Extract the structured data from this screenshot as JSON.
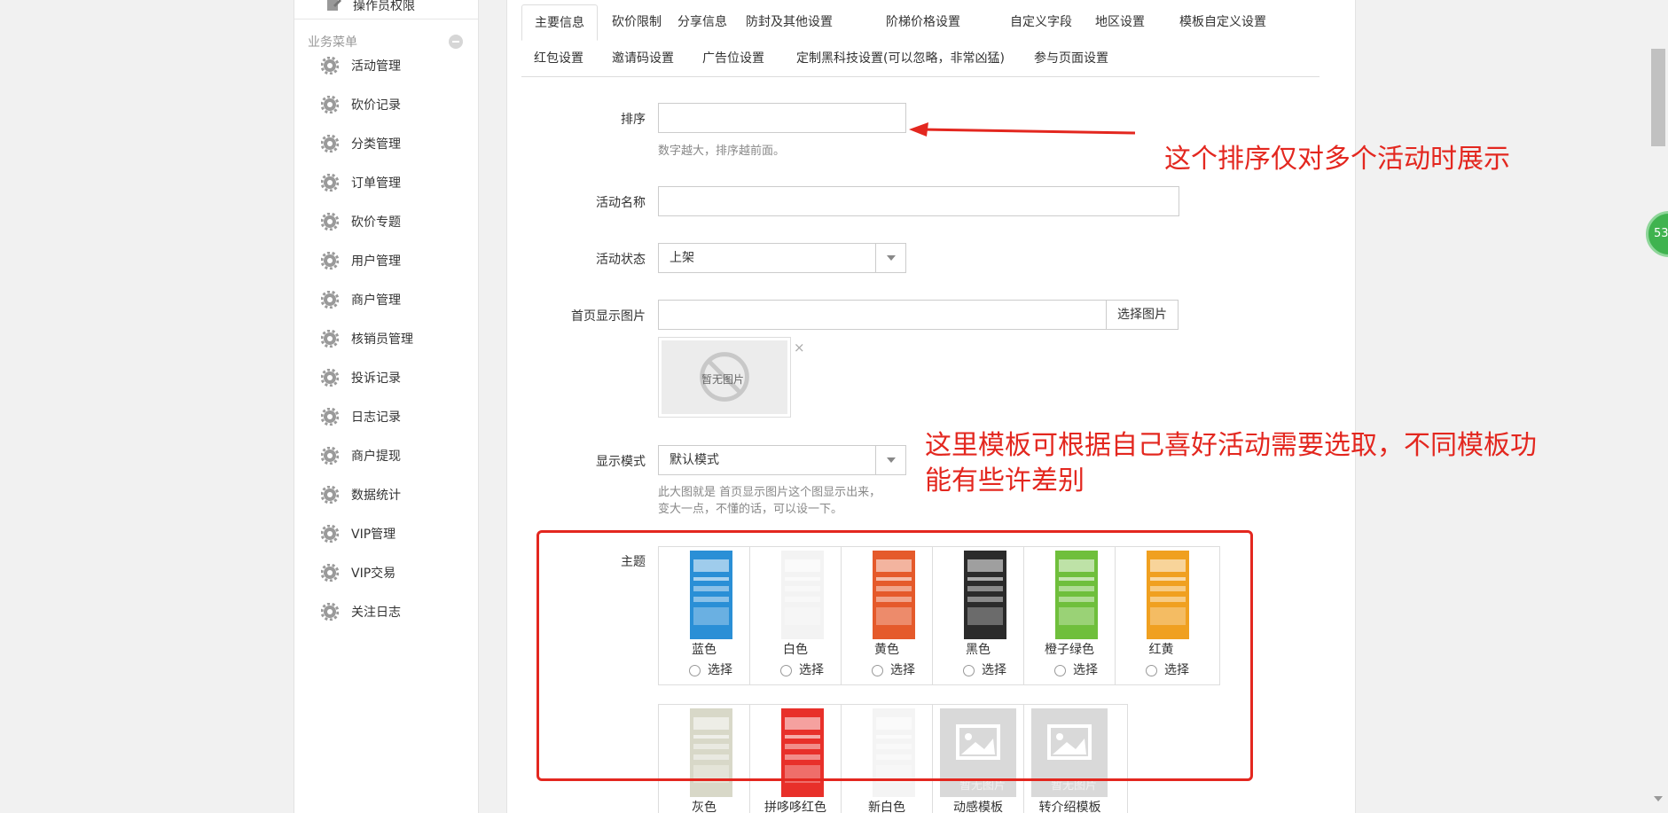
{
  "sidebar": {
    "top_item": "操作员权限",
    "group_title": "业务菜单",
    "items": [
      {
        "label": "活动管理"
      },
      {
        "label": "砍价记录"
      },
      {
        "label": "分类管理"
      },
      {
        "label": "订单管理"
      },
      {
        "label": "砍价专题"
      },
      {
        "label": "用户管理"
      },
      {
        "label": "商户管理"
      },
      {
        "label": "核销员管理"
      },
      {
        "label": "投诉记录"
      },
      {
        "label": "日志记录"
      },
      {
        "label": "商户提现"
      },
      {
        "label": "数据统计"
      },
      {
        "label": "VIP管理"
      },
      {
        "label": "VIP交易"
      },
      {
        "label": "关注日志"
      }
    ]
  },
  "tabs": {
    "row1": [
      "主要信息",
      "砍价限制",
      "分享信息",
      "防封及其他设置",
      "阶梯价格设置",
      "自定义字段",
      "地区设置",
      "模板自定义设置"
    ],
    "row2": [
      "红包设置",
      "邀请码设置",
      "广告位设置",
      "定制黑科技设置(可以忽略，非常凶猛)",
      "参与页面设置"
    ],
    "active": "主要信息"
  },
  "form": {
    "sort": {
      "label": "排序",
      "value": "",
      "help": "数字越大，排序越前面。"
    },
    "name": {
      "label": "活动名称",
      "value": ""
    },
    "status": {
      "label": "活动状态",
      "value": "上架"
    },
    "cover": {
      "label": "首页显示图片",
      "value": "",
      "button": "选择图片",
      "placeholder_img": "暂无图片",
      "close": "×"
    },
    "display_mode": {
      "label": "显示模式",
      "value": "默认模式",
      "help_line1": "此大图就是 首页显示图片这个图显示出来，",
      "help_line2": "变大一点，不懂的话，可以设一下。"
    },
    "theme": {
      "label": "主题",
      "select_label": "选择",
      "row1": [
        {
          "name": "蓝色",
          "color": "#2a8fd6"
        },
        {
          "name": "白色",
          "color": "#f3f3f3"
        },
        {
          "name": "黄色",
          "color": "#e55a2b"
        },
        {
          "name": "黑色",
          "color": "#2b2b2b"
        },
        {
          "name": "橙子绿色",
          "color": "#6fbf3c"
        },
        {
          "name": "红黄",
          "color": "#f0a020"
        }
      ],
      "row2": [
        {
          "name": "灰色",
          "color": "#d8d8c8"
        },
        {
          "name": "拼哆哆红色",
          "color": "#e8302a"
        },
        {
          "name": "新白色",
          "color": "#f4f4f4"
        },
        {
          "name": "动感模板",
          "placeholder": "暂无图片"
        },
        {
          "name": "转介绍模板",
          "placeholder": "暂无图片"
        }
      ]
    }
  },
  "annotations": {
    "sort_note": "这个排序仅对多个活动时展示",
    "theme_note_line1": "这里模板可根据自己喜好活动需要选取，不同模板功",
    "theme_note_line2": "能有些许差别",
    "annotation_color": "#e3271f"
  },
  "floating_badge": "53"
}
